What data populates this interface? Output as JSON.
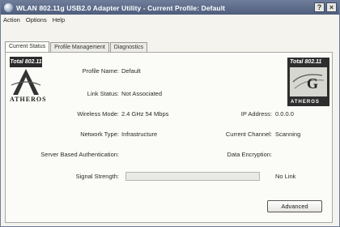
{
  "window": {
    "title": "WLAN 802.11g USB2.0 Adapter Utility - Current Profile: Default",
    "help_label": "?",
    "close_label": "×"
  },
  "menu": [
    "Action",
    "Options",
    "Help"
  ],
  "tabs": [
    {
      "label": "Current Status",
      "active": true
    },
    {
      "label": "Profile Management",
      "active": false
    },
    {
      "label": "Diagnostics",
      "active": false
    }
  ],
  "logos": {
    "left_badge": "Total 802.11",
    "left_word": "ATHEROS",
    "right_badge": "Total 802.11",
    "right_letter": "G",
    "right_word": "ATHEROS"
  },
  "status": {
    "profile_name_label": "Profile Name:",
    "profile_name": "Default",
    "link_status_label": "Link Status:",
    "link_status": "Not Associated",
    "wireless_mode_label": "Wireless Mode:",
    "wireless_mode": "2.4 GHz 54 Mbps",
    "ip_address_label": "IP Address:",
    "ip_address": "0.0.0.0",
    "network_type_label": "Network Type:",
    "network_type": "Infrastructure",
    "current_channel_label": "Current Channel:",
    "current_channel": "Scanning",
    "server_auth_label": "Server Based Authentication:",
    "server_auth": "",
    "data_encryption_label": "Data Encryption:",
    "data_encryption": "",
    "signal_strength_label": "Signal Strength:",
    "signal_strength_fraction": 0,
    "signal_strength_text": "No Link"
  },
  "buttons": {
    "advanced": "Advanced"
  }
}
